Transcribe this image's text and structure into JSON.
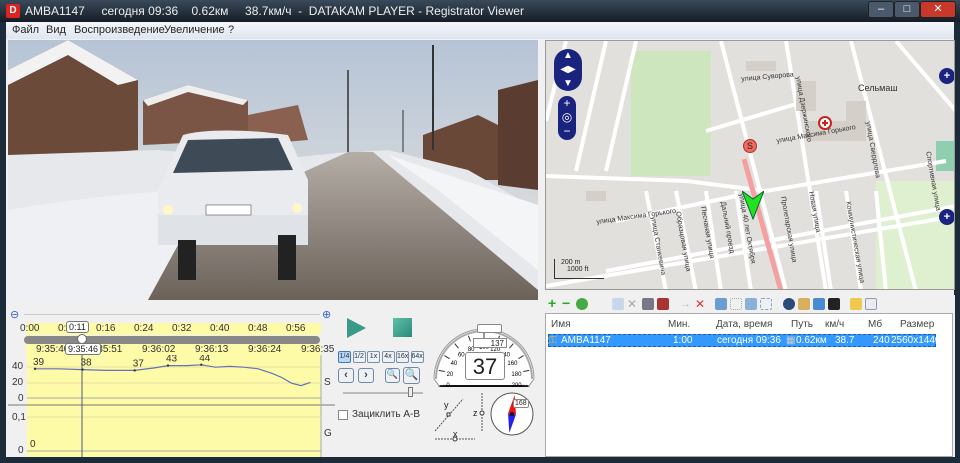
{
  "titlebar": {
    "title": "AMBA1147     сегодня 09:36    0.62км     38.7км/ч  -  DATAKAM PLAYER - Registrator Viewer",
    "app_icon": "D",
    "minimize": "–",
    "maximize": "□",
    "close": "✕"
  },
  "menu": [
    "Файл",
    "Вид",
    "Воспроизведение",
    "Увеличение",
    "?"
  ],
  "timeline": {
    "time_ticks": [
      "0:00",
      "0:08",
      "0:16",
      "0:24",
      "0:32",
      "0:40",
      "0:48",
      "0:56"
    ],
    "current_time": "0:11",
    "clock_ticks": [
      "9:35:40",
      "9:35:51",
      "9:36:02",
      "9:36:13",
      "9:36:24",
      "9:36:35"
    ],
    "current_clock": "9:35:46",
    "progress_fraction": 0.19
  },
  "chart_data": {
    "type": "line",
    "series": [
      {
        "name": "S",
        "x_seconds": [
          0,
          5,
          10,
          15,
          21,
          25,
          28,
          32,
          35,
          38,
          41,
          44,
          47,
          50,
          52,
          54,
          56,
          58
        ],
        "values": [
          39,
          39,
          38,
          37,
          37,
          40,
          43,
          43,
          44,
          41,
          42,
          41,
          39,
          33,
          28,
          21,
          18,
          22
        ]
      }
    ],
    "speed_labels": [
      {
        "t": 0,
        "label": "39"
      },
      {
        "t": 10,
        "label": "38"
      },
      {
        "t": 21,
        "label": "37"
      },
      {
        "t": 28,
        "label": "43"
      },
      {
        "t": 35,
        "label": "44"
      }
    ],
    "s_yticks": [
      "40",
      "20",
      "0"
    ],
    "s_ylim": [
      0,
      50
    ],
    "g_yticks": [
      "0,1",
      "0"
    ],
    "g_value_label": "0",
    "s_axis_label": "S",
    "g_axis_label": "G"
  },
  "controls": {
    "speeds": [
      "1/4",
      "1/2",
      "1x",
      "4x",
      "16x",
      "64x"
    ],
    "active_speed": "1/4",
    "loop_label": "Зациклить A-B",
    "volume_fraction": 0.85
  },
  "gauge": {
    "ticks": [
      "0",
      "20",
      "40",
      "60",
      "80",
      "100",
      "120",
      "140",
      "160",
      "180",
      "200"
    ],
    "speed": "37",
    "speed_value": 37,
    "odometer": "137",
    "heading_label": "168",
    "heading_deg": 168,
    "axis_x": "x",
    "axis_y": "y",
    "axis_z": "z"
  },
  "map": {
    "labels": [
      "улица Суворова",
      "улица Максима Горького",
      "улица Максима Горького",
      "Сельмаш",
      "улица Свердлова",
      "улица Дзержинского",
      "Спортивная улица",
      "Новая улица",
      "улица 40 лет Октября",
      "Пролетарская улица",
      "Дальний проезд",
      "Песчаная улица",
      "Образцовая улица",
      "Коммунистическая улица",
      "улица Станкевича"
    ],
    "scale_m": "200 m",
    "scale_ft": "1000 ft",
    "start_marker": "S"
  },
  "list": {
    "columns": [
      "Имя",
      "Мин.",
      "Дата, время",
      "Путь",
      "км/ч",
      "Мб",
      "Размер"
    ],
    "rows": [
      {
        "name": "AMBA1147",
        "min": "1:00",
        "date": "сегодня 09:36",
        "path": "0.62км",
        "speed": "38.7",
        "mb": "240",
        "size": "2560x1440"
      }
    ]
  }
}
